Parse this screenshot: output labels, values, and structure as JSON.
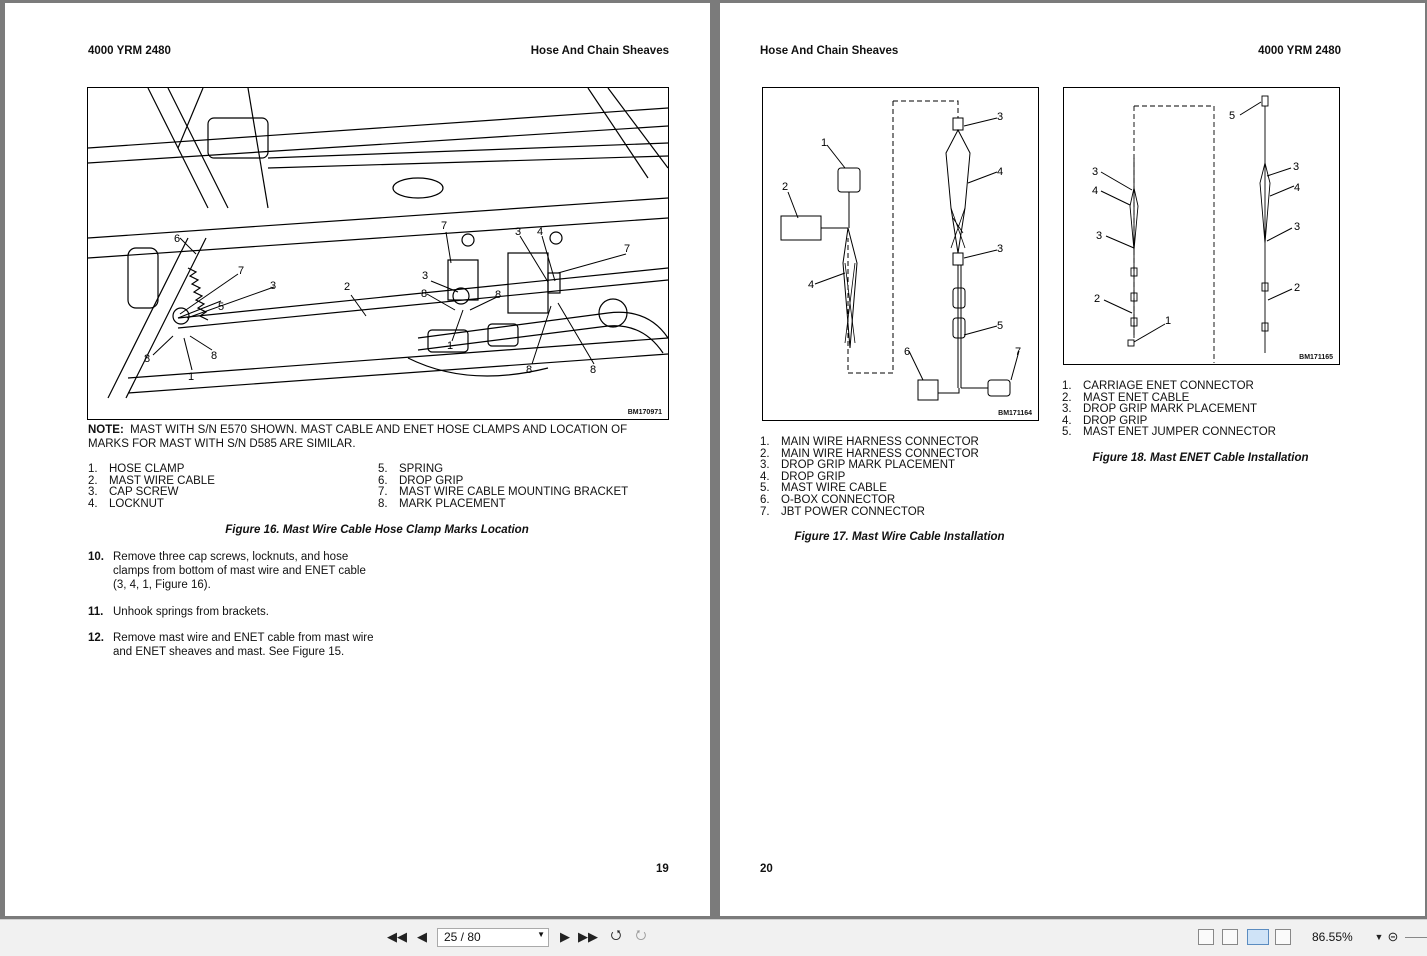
{
  "left_page": {
    "header_left": "4000 YRM 2480",
    "header_right": "Hose And Chain Sheaves",
    "figure_id": "BM170971",
    "callouts": [
      "6",
      "5",
      "7",
      "3",
      "2",
      "7",
      "3",
      "4",
      "7",
      "3",
      "8",
      "8",
      "1",
      "8",
      "8",
      "1",
      "8",
      "8"
    ],
    "note_label": "NOTE:",
    "note_text": "MAST WITH S/N E570 SHOWN. MAST CABLE AND ENET HOSE CLAMPS AND LOCATION OF MARKS FOR MAST WITH S/N D585 ARE SIMILAR.",
    "legend_left": [
      {
        "n": "1.",
        "t": "HOSE CLAMP"
      },
      {
        "n": "2.",
        "t": "MAST WIRE CABLE"
      },
      {
        "n": "3.",
        "t": "CAP SCREW"
      },
      {
        "n": "4.",
        "t": "LOCKNUT"
      }
    ],
    "legend_right": [
      {
        "n": "5.",
        "t": "SPRING"
      },
      {
        "n": "6.",
        "t": "DROP GRIP"
      },
      {
        "n": "7.",
        "t": "MAST WIRE CABLE MOUNTING BRACKET"
      },
      {
        "n": "8.",
        "t": "MARK PLACEMENT"
      }
    ],
    "caption": "Figure 16. Mast Wire Cable Hose Clamp Marks Location",
    "steps": [
      {
        "n": "10.",
        "t": "Remove three cap screws, locknuts, and hose clamps from bottom of mast wire and ENET cable (3, 4, 1, Figure 16)."
      },
      {
        "n": "11.",
        "t": "Unhook springs from brackets."
      },
      {
        "n": "12.",
        "t": "Remove mast wire and ENET cable from mast wire and ENET sheaves and mast. See Figure 15."
      }
    ],
    "page_number": "19"
  },
  "right_page": {
    "header_left": "Hose And Chain Sheaves",
    "header_right": "4000 YRM 2480",
    "fig17": {
      "figure_id": "BM171164",
      "callouts": [
        "1",
        "2",
        "4",
        "3",
        "4",
        "3",
        "5",
        "6",
        "7"
      ],
      "legend": [
        {
          "n": "1.",
          "t": "MAIN WIRE HARNESS CONNECTOR"
        },
        {
          "n": "2.",
          "t": "MAIN WIRE HARNESS CONNECTOR"
        },
        {
          "n": "3.",
          "t": "DROP GRIP MARK PLACEMENT"
        },
        {
          "n": "4.",
          "t": "DROP GRIP"
        },
        {
          "n": "5.",
          "t": "MAST WIRE CABLE"
        },
        {
          "n": "6.",
          "t": "O-BOX CONNECTOR"
        },
        {
          "n": "7.",
          "t": "JBT POWER CONNECTOR"
        }
      ],
      "caption": "Figure 17. Mast Wire Cable Installation"
    },
    "fig18": {
      "figure_id": "BM171165",
      "callouts": [
        "5",
        "3",
        "4",
        "3",
        "2",
        "1",
        "3",
        "4",
        "3",
        "2"
      ],
      "legend": [
        {
          "n": "1.",
          "t": "CARRIAGE ENET CONNECTOR"
        },
        {
          "n": "2.",
          "t": "MAST ENET CABLE"
        },
        {
          "n": "3.",
          "t": "DROP GRIP MARK PLACEMENT"
        },
        {
          "n": "4.",
          "t": "DROP GRIP"
        },
        {
          "n": "5.",
          "t": "MAST ENET JUMPER CONNECTOR"
        }
      ],
      "caption": "Figure 18. Mast ENET Cable Installation"
    },
    "page_number": "20"
  },
  "toolbar": {
    "page_indicator": "25 / 80",
    "zoom": "86.55%",
    "icons": [
      "first-page-icon",
      "prev-page-icon",
      "next-page-icon",
      "last-page-icon",
      "prev-view-icon",
      "next-view-icon",
      "single-page-icon",
      "continuous-icon",
      "facing-icon",
      "continuous-facing-icon",
      "zoom-out-icon"
    ]
  }
}
